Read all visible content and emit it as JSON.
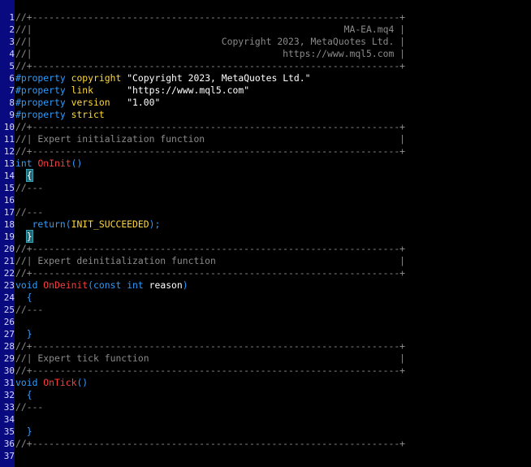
{
  "editor": {
    "lines": [
      {
        "n": "1",
        "segs": [
          {
            "t": "//+------------------------------------------------------------------+",
            "c": "c"
          }
        ]
      },
      {
        "n": "2",
        "segs": [
          {
            "t": "//|                                                        MA-EA.mq4 |",
            "c": "c"
          }
        ]
      },
      {
        "n": "3",
        "segs": [
          {
            "t": "//|                                  Copyright 2023, MetaQuotes Ltd. |",
            "c": "c"
          }
        ]
      },
      {
        "n": "4",
        "segs": [
          {
            "t": "//|                                             https://www.mql5.com |",
            "c": "c"
          }
        ]
      },
      {
        "n": "5",
        "segs": [
          {
            "t": "//+------------------------------------------------------------------+",
            "c": "c"
          }
        ]
      },
      {
        "n": "6",
        "segs": [
          {
            "t": "#property",
            "c": "pp"
          },
          {
            "t": " ",
            "c": "id"
          },
          {
            "t": "copyright",
            "c": "const"
          },
          {
            "t": " ",
            "c": "id"
          },
          {
            "t": "\"Copyright 2023, MetaQuotes Ltd.\"",
            "c": "str"
          }
        ]
      },
      {
        "n": "7",
        "segs": [
          {
            "t": "#property",
            "c": "pp"
          },
          {
            "t": " ",
            "c": "id"
          },
          {
            "t": "link",
            "c": "const"
          },
          {
            "t": "      ",
            "c": "id"
          },
          {
            "t": "\"https://www.mql5.com\"",
            "c": "str"
          }
        ]
      },
      {
        "n": "8",
        "segs": [
          {
            "t": "#property",
            "c": "pp"
          },
          {
            "t": " ",
            "c": "id"
          },
          {
            "t": "version",
            "c": "const"
          },
          {
            "t": "   ",
            "c": "id"
          },
          {
            "t": "\"1.00\"",
            "c": "str"
          }
        ]
      },
      {
        "n": "9",
        "segs": [
          {
            "t": "#property",
            "c": "pp"
          },
          {
            "t": " ",
            "c": "id"
          },
          {
            "t": "strict",
            "c": "const"
          }
        ]
      },
      {
        "n": "10",
        "segs": [
          {
            "t": "//+------------------------------------------------------------------+",
            "c": "c"
          }
        ]
      },
      {
        "n": "11",
        "segs": [
          {
            "t": "//| Expert initialization function                                   |",
            "c": "c"
          }
        ]
      },
      {
        "n": "12",
        "segs": [
          {
            "t": "//+------------------------------------------------------------------+",
            "c": "c"
          }
        ]
      },
      {
        "n": "13",
        "segs": [
          {
            "t": "int",
            "c": "kw"
          },
          {
            "t": " ",
            "c": "id"
          },
          {
            "t": "OnInit",
            "c": "fn"
          },
          {
            "t": "()",
            "c": "op"
          }
        ]
      },
      {
        "n": "14",
        "segs": [
          {
            "t": "  ",
            "c": "id"
          },
          {
            "t": "{",
            "c": "brace-hl"
          }
        ]
      },
      {
        "n": "15",
        "segs": [
          {
            "t": "//---",
            "c": "c"
          }
        ]
      },
      {
        "n": "16",
        "segs": []
      },
      {
        "n": "17",
        "segs": [
          {
            "t": "//---",
            "c": "c"
          }
        ]
      },
      {
        "n": "18",
        "segs": [
          {
            "t": "   ",
            "c": "id"
          },
          {
            "t": "return",
            "c": "kw"
          },
          {
            "t": "(",
            "c": "op"
          },
          {
            "t": "INIT_SUCCEEDED",
            "c": "const"
          },
          {
            "t": ");",
            "c": "op"
          }
        ]
      },
      {
        "n": "19",
        "segs": [
          {
            "t": "  ",
            "c": "id"
          },
          {
            "t": "}",
            "c": "brace-hl"
          }
        ]
      },
      {
        "n": "20",
        "segs": [
          {
            "t": "//+------------------------------------------------------------------+",
            "c": "c"
          }
        ]
      },
      {
        "n": "21",
        "segs": [
          {
            "t": "//| Expert deinitialization function                                 |",
            "c": "c"
          }
        ]
      },
      {
        "n": "22",
        "segs": [
          {
            "t": "//+------------------------------------------------------------------+",
            "c": "c"
          }
        ]
      },
      {
        "n": "23",
        "segs": [
          {
            "t": "void",
            "c": "kw"
          },
          {
            "t": " ",
            "c": "id"
          },
          {
            "t": "OnDeinit",
            "c": "fn"
          },
          {
            "t": "(",
            "c": "op"
          },
          {
            "t": "const",
            "c": "kw"
          },
          {
            "t": " ",
            "c": "id"
          },
          {
            "t": "int",
            "c": "kw"
          },
          {
            "t": " reason",
            "c": "id"
          },
          {
            "t": ")",
            "c": "op"
          }
        ]
      },
      {
        "n": "24",
        "segs": [
          {
            "t": "  ",
            "c": "id"
          },
          {
            "t": "{",
            "c": "op"
          }
        ]
      },
      {
        "n": "25",
        "segs": [
          {
            "t": "//---",
            "c": "c"
          }
        ]
      },
      {
        "n": "26",
        "segs": []
      },
      {
        "n": "27",
        "segs": [
          {
            "t": "  ",
            "c": "id"
          },
          {
            "t": "}",
            "c": "op"
          }
        ]
      },
      {
        "n": "28",
        "segs": [
          {
            "t": "//+------------------------------------------------------------------+",
            "c": "c"
          }
        ]
      },
      {
        "n": "29",
        "segs": [
          {
            "t": "//| Expert tick function                                             |",
            "c": "c"
          }
        ]
      },
      {
        "n": "30",
        "segs": [
          {
            "t": "//+------------------------------------------------------------------+",
            "c": "c"
          }
        ]
      },
      {
        "n": "31",
        "segs": [
          {
            "t": "void",
            "c": "kw"
          },
          {
            "t": " ",
            "c": "id"
          },
          {
            "t": "OnTick",
            "c": "fn"
          },
          {
            "t": "()",
            "c": "op"
          }
        ]
      },
      {
        "n": "32",
        "segs": [
          {
            "t": "  ",
            "c": "id"
          },
          {
            "t": "{",
            "c": "op"
          }
        ]
      },
      {
        "n": "33",
        "segs": [
          {
            "t": "//---",
            "c": "c"
          }
        ]
      },
      {
        "n": "34",
        "segs": []
      },
      {
        "n": "35",
        "segs": [
          {
            "t": "  ",
            "c": "id"
          },
          {
            "t": "}",
            "c": "op"
          }
        ]
      },
      {
        "n": "36",
        "segs": [
          {
            "t": "//+------------------------------------------------------------------+",
            "c": "c"
          }
        ]
      },
      {
        "n": "37",
        "segs": []
      }
    ]
  },
  "colors": {
    "background": "#000000",
    "gutter": "#0a0a80",
    "comment": "#8a8a8a",
    "keyword": "#2e9cff",
    "function": "#ff3d3d",
    "constant": "#ffd83a",
    "string": "#ffffff",
    "brace_highlight": "#1d6b78"
  }
}
